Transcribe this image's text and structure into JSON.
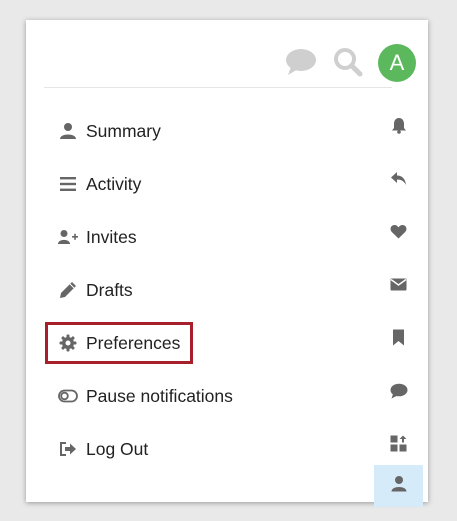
{
  "colors": {
    "accent_avatar": "#5cb85c",
    "icon_gray": "#666666",
    "light_icon_gray": "#cfcfcf",
    "highlight_border": "#a71f2a",
    "rail_active_bg": "#d6ebfa"
  },
  "header": {
    "chat_icon": "chat-bubble-icon",
    "search_icon": "search-icon",
    "avatar_letter": "A"
  },
  "menu": {
    "items": [
      {
        "label": "Summary",
        "icon": "user-icon"
      },
      {
        "label": "Activity",
        "icon": "list-icon"
      },
      {
        "label": "Invites",
        "icon": "user-plus-icon"
      },
      {
        "label": "Drafts",
        "icon": "pencil-icon"
      },
      {
        "label": "Preferences",
        "icon": "gear-icon",
        "highlighted": true
      },
      {
        "label": "Pause notifications",
        "icon": "toggle-icon"
      },
      {
        "label": "Log Out",
        "icon": "sign-out-icon"
      }
    ]
  },
  "rail": {
    "items": [
      {
        "icon": "bell-icon"
      },
      {
        "icon": "reply-icon"
      },
      {
        "icon": "heart-icon"
      },
      {
        "icon": "envelope-icon"
      },
      {
        "icon": "bookmark-icon"
      },
      {
        "icon": "comment-icon"
      },
      {
        "icon": "grid-icon"
      },
      {
        "icon": "user-icon",
        "active": true
      }
    ]
  }
}
